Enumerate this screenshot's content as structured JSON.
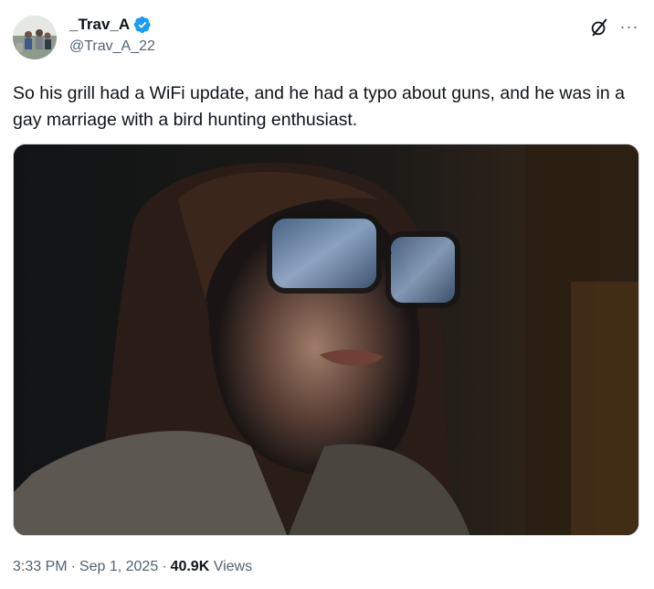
{
  "author": {
    "display_name": "_Trav_A",
    "handle": "@Trav_A_22",
    "verified": true,
    "verified_color": "#1d9bf0"
  },
  "actions": {
    "grok_icon": "grok-slash-circle-icon",
    "more_label": "···"
  },
  "tweet": {
    "text": "So his grill had a WiFi update, and he had a typo about guns, and he was in a gay marriage with a bird hunting enthusiast."
  },
  "media": {
    "type": "image",
    "icon": "photo"
  },
  "meta": {
    "time": "3:33 PM",
    "date": "Sep 1, 2025",
    "separator": "·",
    "views_count": "40.9K",
    "views_label": "Views"
  },
  "colors": {
    "text_primary": "#0f1419",
    "text_secondary": "#536471",
    "border": "#cfd9de"
  }
}
